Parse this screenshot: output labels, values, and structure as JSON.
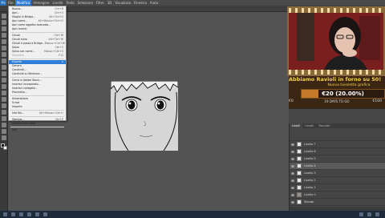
{
  "menubar": {
    "logo": "Ps",
    "items": [
      "File",
      "Modifica",
      "Immagine",
      "Livello",
      "Testo",
      "Selezione",
      "Filtro",
      "3D",
      "Visualizza",
      "Finestra",
      "Aiuto"
    ],
    "active_index": 1
  },
  "dropdown": {
    "rows": [
      {
        "label": "Nuovo...",
        "shortcut": "Ctrl+N"
      },
      {
        "label": "Apri...",
        "shortcut": "Ctrl+O"
      },
      {
        "label": "Sfoglia in Bridge...",
        "shortcut": "Alt+Ctrl+O"
      },
      {
        "label": "Apri come...",
        "shortcut": "Alt+Maiusc+Ctrl+O"
      },
      {
        "label": "Apri come oggetto avanzato...",
        "shortcut": ""
      },
      {
        "label": "Apri recenti",
        "shortcut": ""
      },
      {
        "sep": true
      },
      {
        "label": "Chiudi",
        "shortcut": "Ctrl+W"
      },
      {
        "label": "Chiudi tutto",
        "shortcut": "Alt+Ctrl+W"
      },
      {
        "label": "Chiudi e passa a Bridge...",
        "shortcut": "Maiusc+Ctrl+W"
      },
      {
        "label": "Salva",
        "shortcut": "Ctrl+S"
      },
      {
        "label": "Salva con nome...",
        "shortcut": "Maiusc+Ctrl+S"
      },
      {
        "label": "Ripristina",
        "shortcut": "F12",
        "disabled": true
      },
      {
        "sep": true
      },
      {
        "label": "Esporta",
        "shortcut": "",
        "highlight": true
      },
      {
        "label": "Genera",
        "shortcut": ""
      },
      {
        "label": "Condividi...",
        "shortcut": ""
      },
      {
        "label": "Condividi su Behance...",
        "shortcut": ""
      },
      {
        "sep": true
      },
      {
        "label": "Cerca in Adobe Stock...",
        "shortcut": ""
      },
      {
        "label": "Inserisci incorporato...",
        "shortcut": ""
      },
      {
        "label": "Inserisci collegato...",
        "shortcut": ""
      },
      {
        "label": "Pacchetto...",
        "shortcut": ""
      },
      {
        "sep": true
      },
      {
        "label": "Automatizza",
        "shortcut": ""
      },
      {
        "label": "Script",
        "shortcut": ""
      },
      {
        "label": "Importa",
        "shortcut": ""
      },
      {
        "sep": true
      },
      {
        "label": "Info file...",
        "shortcut": "Alt+Maiusc+Ctrl+I"
      },
      {
        "sep": true
      },
      {
        "label": "Stampa...",
        "shortcut": "Ctrl+P"
      },
      {
        "label": "Stampa una copia",
        "shortcut": "Alt+Maiusc+Ctrl+P"
      },
      {
        "sep": true
      },
      {
        "label": "Esci",
        "shortcut": "Ctrl+Q"
      }
    ]
  },
  "donation": {
    "marquee": "Abbiamo Ravioli in forno su 50!",
    "subtitle": "Nuova tavoletta grafica",
    "goal_text": "€20 (20.00%)",
    "goal_percent": 20,
    "min_label": "€0",
    "days_label": "19 DAYS TO GO",
    "max_label": "€100"
  },
  "layers": {
    "tabs": [
      "Livelli",
      "Canali",
      "Tracciati"
    ],
    "rows": [
      {
        "name": "Livello 7",
        "thumb": "light"
      },
      {
        "name": "Livello 6",
        "thumb": "light"
      },
      {
        "name": "Livello 5",
        "thumb": "light"
      },
      {
        "name": "Livello 4",
        "thumb": "light",
        "selected": true
      },
      {
        "name": "Livello 3",
        "thumb": "light"
      },
      {
        "name": "Livello 2",
        "thumb": "light"
      },
      {
        "name": "Livello 1",
        "thumb": "light"
      },
      {
        "name": "Livello 0",
        "thumb": "dark"
      },
      {
        "name": "Sfondo",
        "thumb": "light"
      }
    ]
  },
  "colors": {
    "accent": "#2f7fd8",
    "donation_text": "#f3d24a",
    "webcam_bg": "#7a1f1f"
  }
}
